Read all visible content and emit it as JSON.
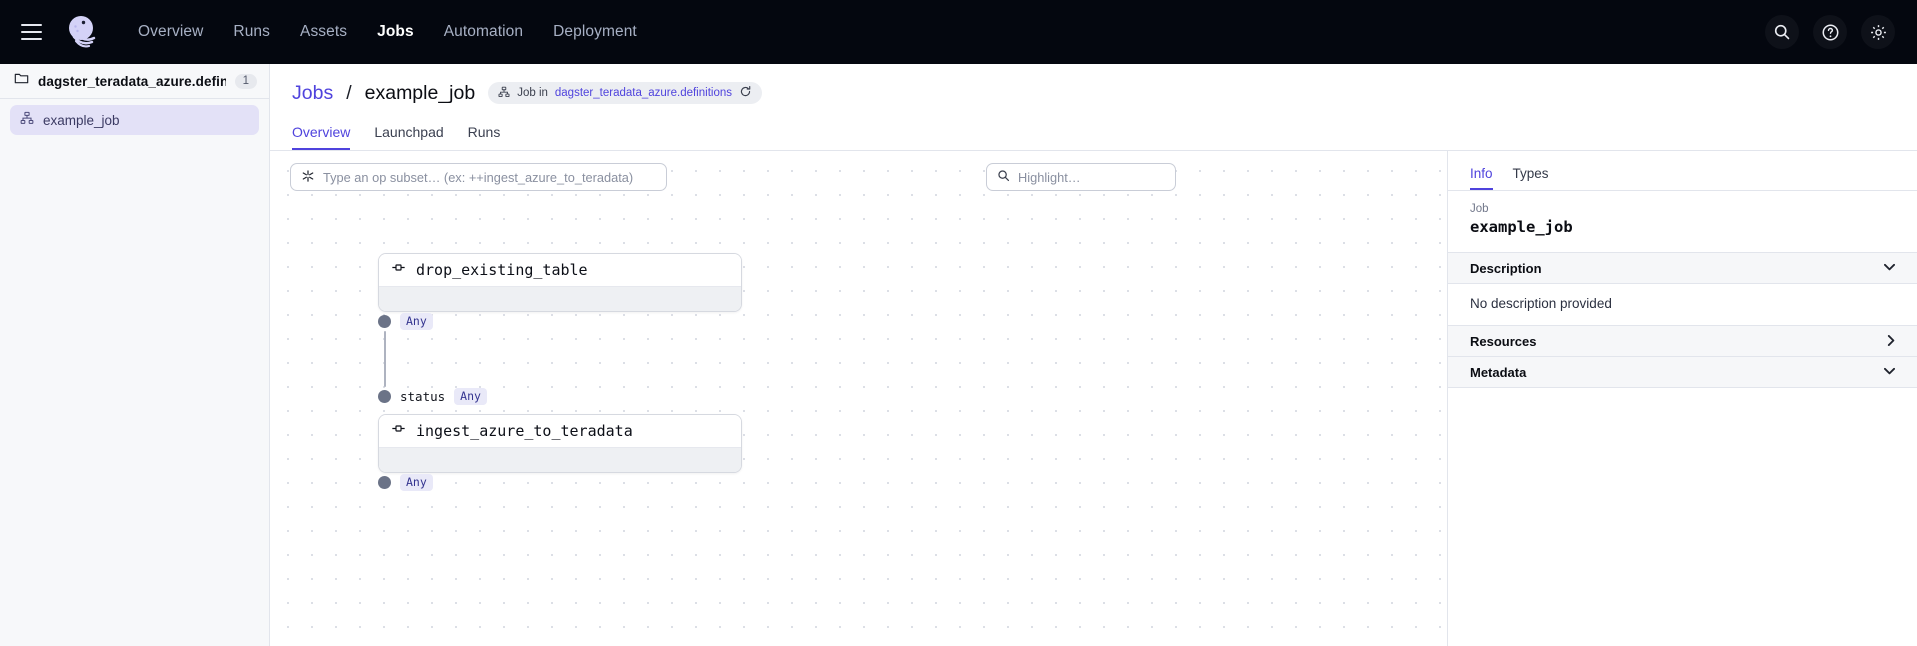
{
  "topnav": {
    "menu_icon": "hamburger-menu-icon",
    "logo_icon": "dagster-logo-icon",
    "links": [
      {
        "label": "Overview",
        "active": false
      },
      {
        "label": "Runs",
        "active": false
      },
      {
        "label": "Assets",
        "active": false
      },
      {
        "label": "Jobs",
        "active": true
      },
      {
        "label": "Automation",
        "active": false
      },
      {
        "label": "Deployment",
        "active": false
      }
    ],
    "actions": [
      {
        "icon": "search-icon"
      },
      {
        "icon": "help-icon"
      },
      {
        "icon": "gear-icon"
      }
    ]
  },
  "sidebar": {
    "repository": {
      "icon": "folder-icon",
      "name": "dagster_teradata_azure.definitions",
      "count": "1"
    },
    "items": [
      {
        "icon": "job-graph-icon",
        "label": "example_job",
        "selected": true
      }
    ]
  },
  "header": {
    "breadcrumb": {
      "root": "Jobs",
      "separator": "/",
      "current": "example_job"
    },
    "pill": {
      "icon": "job-graph-icon",
      "prefix": "Job in ",
      "link": "dagster_teradata_azure.definitions",
      "reload_icon": "reload-icon"
    },
    "tabs": [
      {
        "label": "Overview",
        "active": true
      },
      {
        "label": "Launchpad",
        "active": false
      },
      {
        "label": "Runs",
        "active": false
      }
    ]
  },
  "graph": {
    "op_subset": {
      "icon": "op-subset-icon",
      "placeholder": "Type an op subset… (ex: ++ingest_azure_to_teradata)",
      "value": ""
    },
    "highlight": {
      "icon": "search-icon",
      "placeholder": "Highlight…",
      "value": ""
    },
    "nodes": [
      {
        "icon": "op-icon",
        "name": "drop_existing_table",
        "outputs": [
          {
            "name": "",
            "type": "Any"
          }
        ]
      },
      {
        "icon": "op-icon",
        "name": "ingest_azure_to_teradata",
        "inputs": [
          {
            "name": "status",
            "type": "Any"
          }
        ],
        "outputs": [
          {
            "name": "",
            "type": "Any"
          }
        ]
      }
    ]
  },
  "rightpanel": {
    "tabs": [
      {
        "label": "Info",
        "active": true
      },
      {
        "label": "Types",
        "active": false
      }
    ],
    "job_kicker": "Job",
    "job_name": "example_job",
    "sections": [
      {
        "title": "Description",
        "expanded": true,
        "body": "No description provided"
      },
      {
        "title": "Resources",
        "expanded": false,
        "body": ""
      },
      {
        "title": "Metadata",
        "expanded": true,
        "body": ""
      }
    ]
  },
  "colors": {
    "accent": "#4f43dd",
    "topnav_bg": "#04070f",
    "sidebar_bg": "#f7f8fa",
    "selected_item_bg": "#e3e1f7",
    "port_dot": "#6b7387",
    "type_chip_bg": "#e9e9f8"
  }
}
